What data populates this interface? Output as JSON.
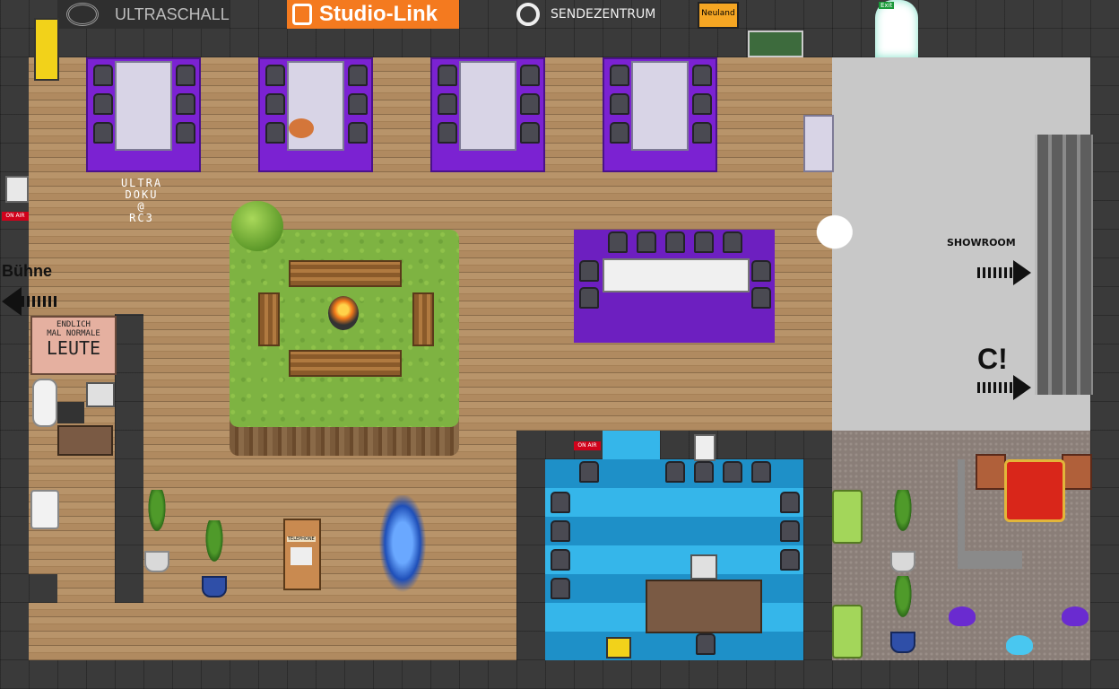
{
  "logos": {
    "ultraschall": "ULTRASCHALL",
    "studio_link": "Studio-Link",
    "sendezentrum": "SENDEZENTRUM",
    "neuland": "Neuland",
    "exit": "Exit"
  },
  "signs": {
    "ultra_doku_line1": "ULTRA",
    "ultra_doku_line2": "DOKU",
    "ultra_doku_line3": "@",
    "ultra_doku_line4": "RC3",
    "on_air_left": "ON AIR",
    "on_air_studio": "ON AIR",
    "buehne": "Bühne",
    "endlich_line1": "ENDLICH",
    "endlich_line2": "MAL NORMALE",
    "endlich_line3": "LEUTE",
    "telephone": "TELEPHONE",
    "showroom": "SHOWROOM",
    "c_exclaim": "C!"
  },
  "colors": {
    "studio_link_orange": "#f47a1f",
    "neuland_yellow": "#f5a623",
    "on_air_red": "#d0021b",
    "purple_room": "#6d1fc0",
    "blue_room": "#2aa6dd"
  }
}
